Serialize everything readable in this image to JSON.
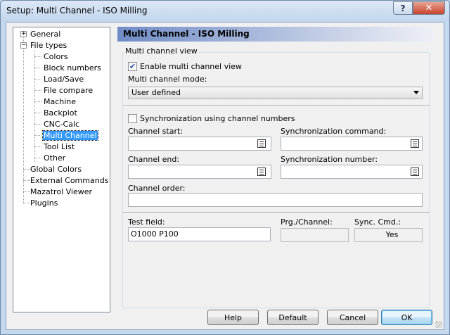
{
  "window": {
    "title": "Setup: Multi Channel - ISO Milling",
    "help_glyph": "?",
    "close_glyph": "✕"
  },
  "tree": {
    "items": [
      {
        "label": "General",
        "expander": "+"
      },
      {
        "label": "File types",
        "expander": "−"
      },
      {
        "label": "Colors"
      },
      {
        "label": "Block numbers"
      },
      {
        "label": "Load/Save"
      },
      {
        "label": "File compare"
      },
      {
        "label": "Machine"
      },
      {
        "label": "Backplot"
      },
      {
        "label": "CNC-Calc"
      },
      {
        "label": "Multi Channel",
        "selected": true
      },
      {
        "label": "Tool List"
      },
      {
        "label": "Other"
      },
      {
        "label": "Global Colors"
      },
      {
        "label": "External Commands"
      },
      {
        "label": "Mazatrol Viewer"
      },
      {
        "label": "Plugins"
      }
    ]
  },
  "panel": {
    "header": "Multi Channel - ISO Milling",
    "group_label": "Multi channel view",
    "enable_view": {
      "label": "Enable multi channel view",
      "checked": true
    },
    "mode_label": "Multi channel mode:",
    "mode_value": "User defined",
    "sync_numbers": {
      "label": "Synchronization using channel numbers",
      "checked": false
    },
    "channel_start_label": "Channel start:",
    "channel_start_value": "",
    "sync_command_label": "Synchronization command:",
    "sync_command_value": "",
    "channel_end_label": "Channel end:",
    "channel_end_value": "",
    "sync_number_label": "Synchronization number:",
    "sync_number_value": "",
    "channel_order_label": "Channel order:",
    "channel_order_value": "",
    "test_field_label": "Test field:",
    "test_field_value": "O1000 P100",
    "prg_channel_label": "Prg./Channel:",
    "prg_channel_value": "",
    "sync_cmd_label": "Sync. Cmd.:",
    "sync_cmd_value": "Yes"
  },
  "buttons": {
    "help": "Help",
    "default": "Default",
    "cancel": "Cancel",
    "ok": "OK"
  },
  "colors": {
    "selection": "#3399ff",
    "header_start": "#6f8bc6",
    "close": "#c7422c"
  }
}
